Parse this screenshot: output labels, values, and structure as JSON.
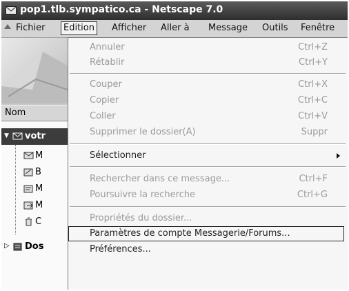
{
  "window": {
    "title": "pop1.tlb.sympatico.ca - Netscape 7.0"
  },
  "menubar": {
    "items": [
      {
        "label": "Fichier"
      },
      {
        "label": "Edition"
      },
      {
        "label": "Afficher"
      },
      {
        "label": "Aller à"
      },
      {
        "label": "Message"
      },
      {
        "label": "Outils"
      },
      {
        "label": "Fenêtre"
      }
    ]
  },
  "folder_pane": {
    "column_header": "Nom",
    "account_label": "votr",
    "other_account_label": "Dos",
    "subfolder_letters": [
      "M",
      "B",
      "M",
      "M",
      "C"
    ]
  },
  "edit_menu": {
    "items": [
      {
        "label": "Annuler",
        "shortcut": "Ctrl+Z",
        "enabled": false
      },
      {
        "label": "Rétablir",
        "shortcut": "Ctrl+Y",
        "enabled": false
      },
      {
        "label": "Couper",
        "shortcut": "Ctrl+X",
        "enabled": false
      },
      {
        "label": "Copier",
        "shortcut": "Ctrl+C",
        "enabled": false
      },
      {
        "label": "Coller",
        "shortcut": "Ctrl+V",
        "enabled": false
      },
      {
        "label": "Supprimer le dossier(A)",
        "shortcut": "Suppr",
        "enabled": false
      },
      {
        "label": "Sélectionner",
        "shortcut": "",
        "enabled": true,
        "submenu": true
      },
      {
        "label": "Rechercher dans ce message...",
        "shortcut": "Ctrl+F",
        "enabled": false
      },
      {
        "label": "Poursuivre la recherche",
        "shortcut": "Ctrl+G",
        "enabled": false
      },
      {
        "label": "Propriétés du dossier...",
        "shortcut": "",
        "enabled": false
      },
      {
        "label": "Paramètres de compte Messagerie/Forums...",
        "shortcut": "",
        "enabled": true,
        "highlighted": true
      },
      {
        "label": "Préférences...",
        "shortcut": "",
        "enabled": true
      }
    ]
  }
}
